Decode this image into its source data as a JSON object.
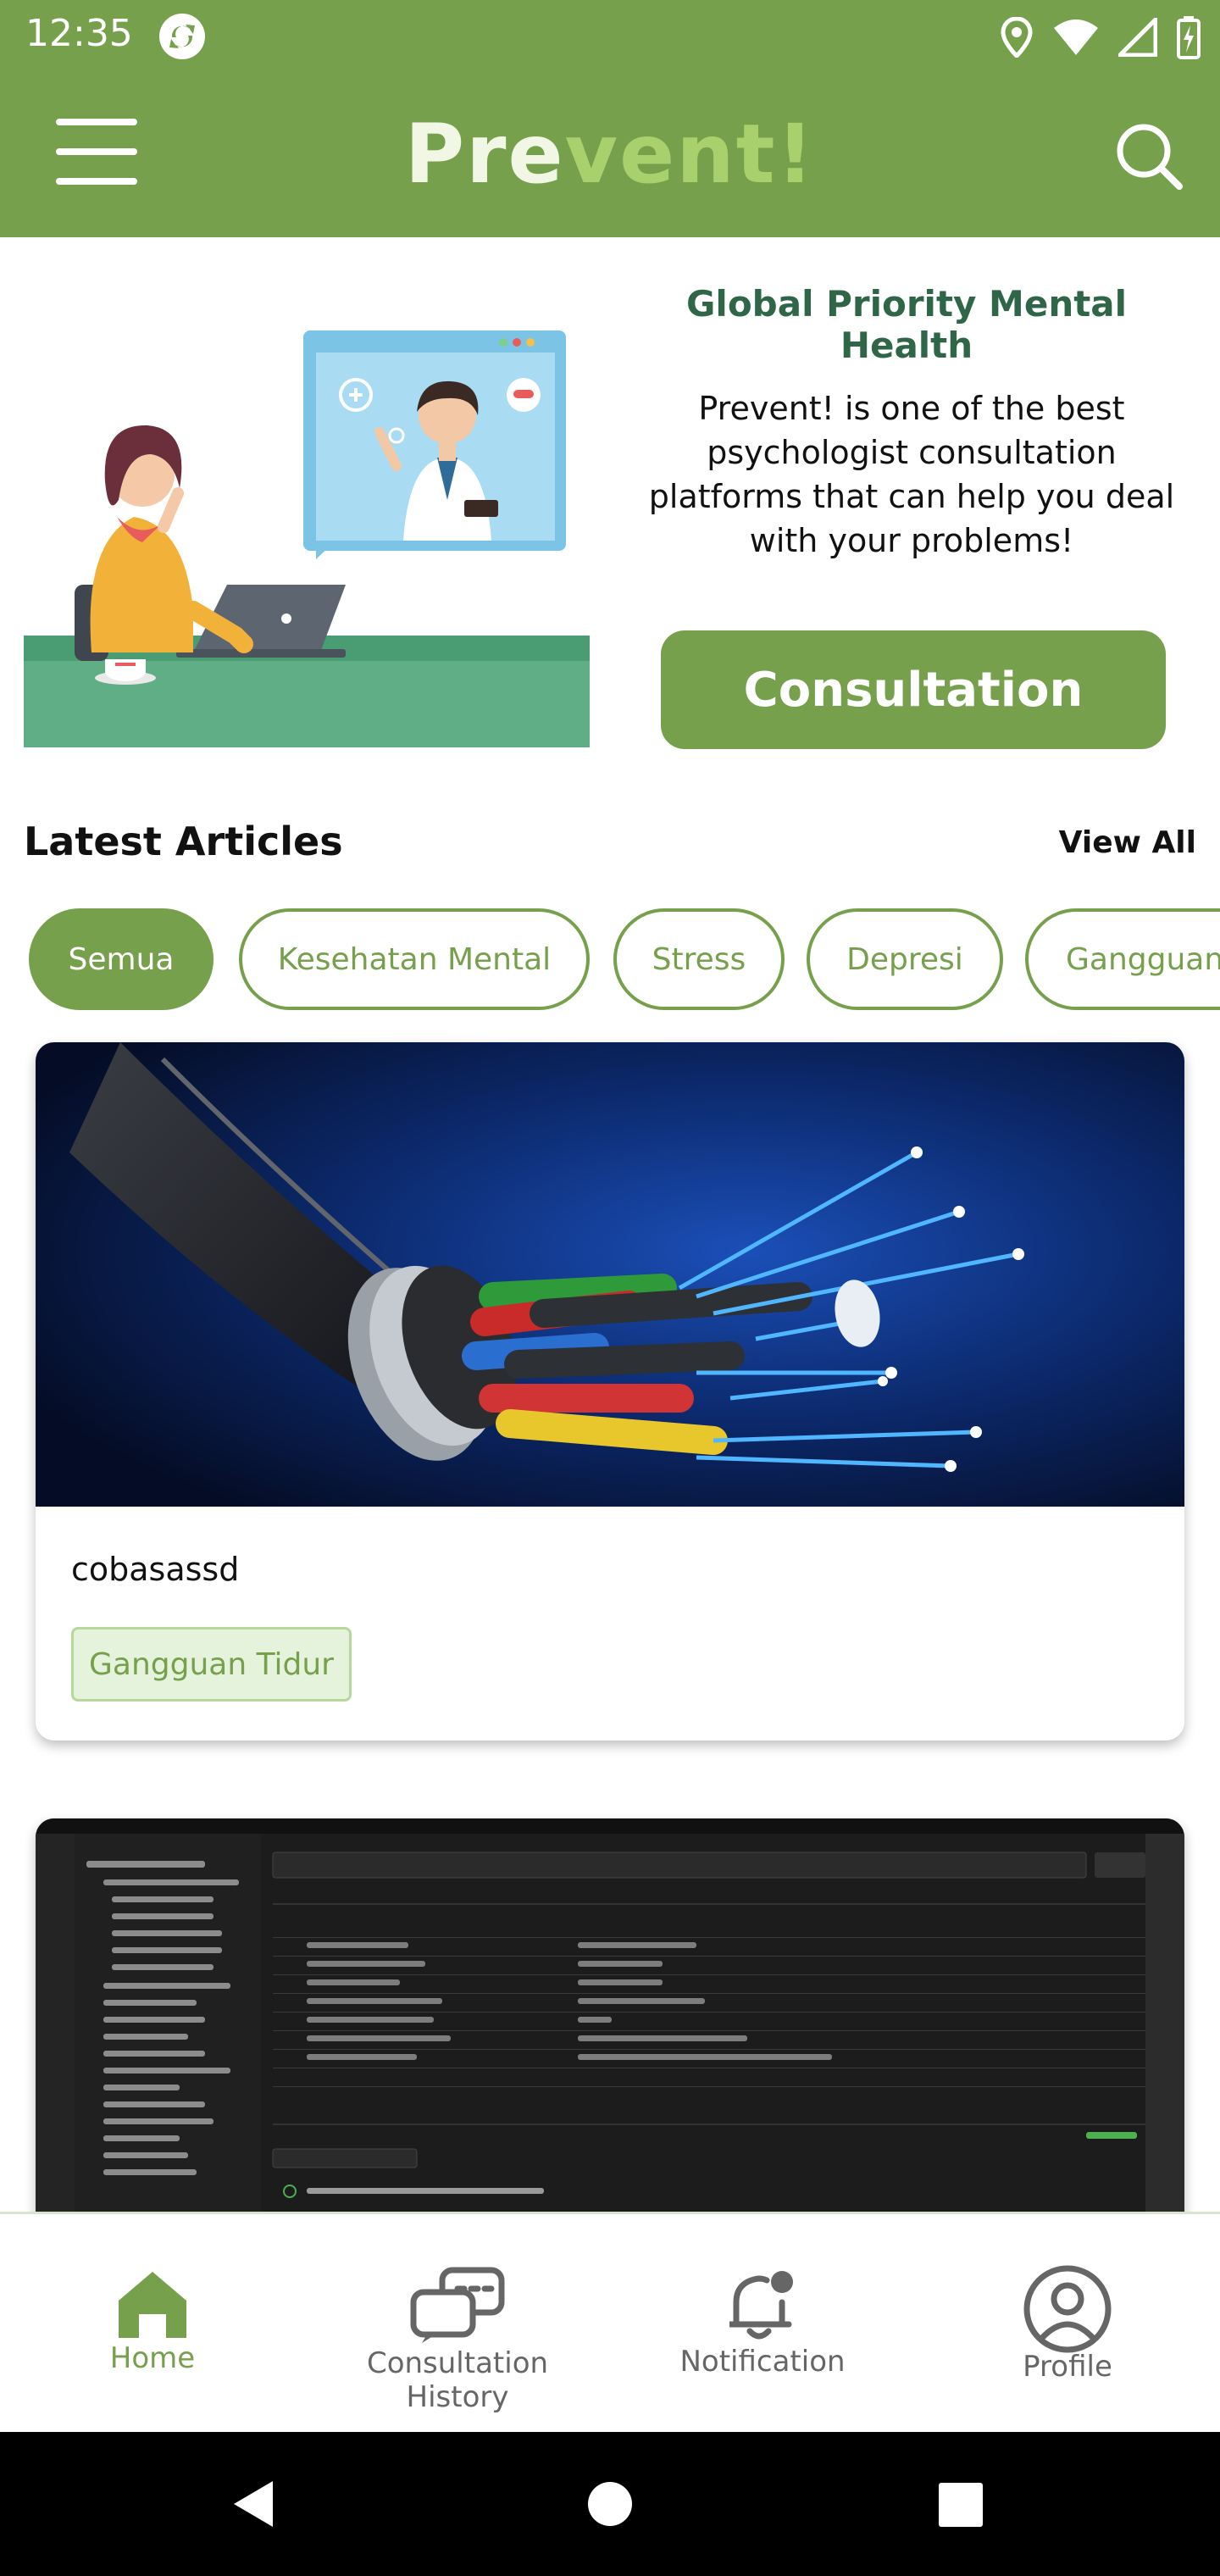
{
  "status_bar": {
    "time": "12:35",
    "icons": [
      "app-sync-icon",
      "location-icon",
      "wifi-icon",
      "signal-icon",
      "battery-icon"
    ]
  },
  "app_bar": {
    "logo_part1": "Pre",
    "logo_part2": "vent!",
    "menu_icon": "hamburger-menu-icon",
    "search_icon": "search-icon"
  },
  "hero": {
    "title": "Global Priority Mental Health",
    "description": "Prevent! is one of the best psychologist consultation platforms that can help you deal with your problems!",
    "button_label": "Consultation"
  },
  "articles": {
    "section_title": "Latest Articles",
    "view_all_label": "View All",
    "categories": [
      "Semua",
      "Kesehatan Mental",
      "Stress",
      "Depresi",
      "Gangguan"
    ],
    "active_category": "Semua",
    "items": [
      {
        "title": "cobasassd",
        "tag": "Gangguan Tidur"
      }
    ]
  },
  "bottom_nav": {
    "items": [
      {
        "label": "Home",
        "icon": "home-icon"
      },
      {
        "label": "Consultation History",
        "icon": "chat-history-icon"
      },
      {
        "label": "Notification",
        "icon": "bell-icon"
      },
      {
        "label": "Profile",
        "icon": "user-circle-icon"
      }
    ],
    "active": "Home"
  },
  "colors": {
    "primary": "#76a04c",
    "title_green": "#2f6648",
    "tag_bg": "#e5f3dc"
  }
}
